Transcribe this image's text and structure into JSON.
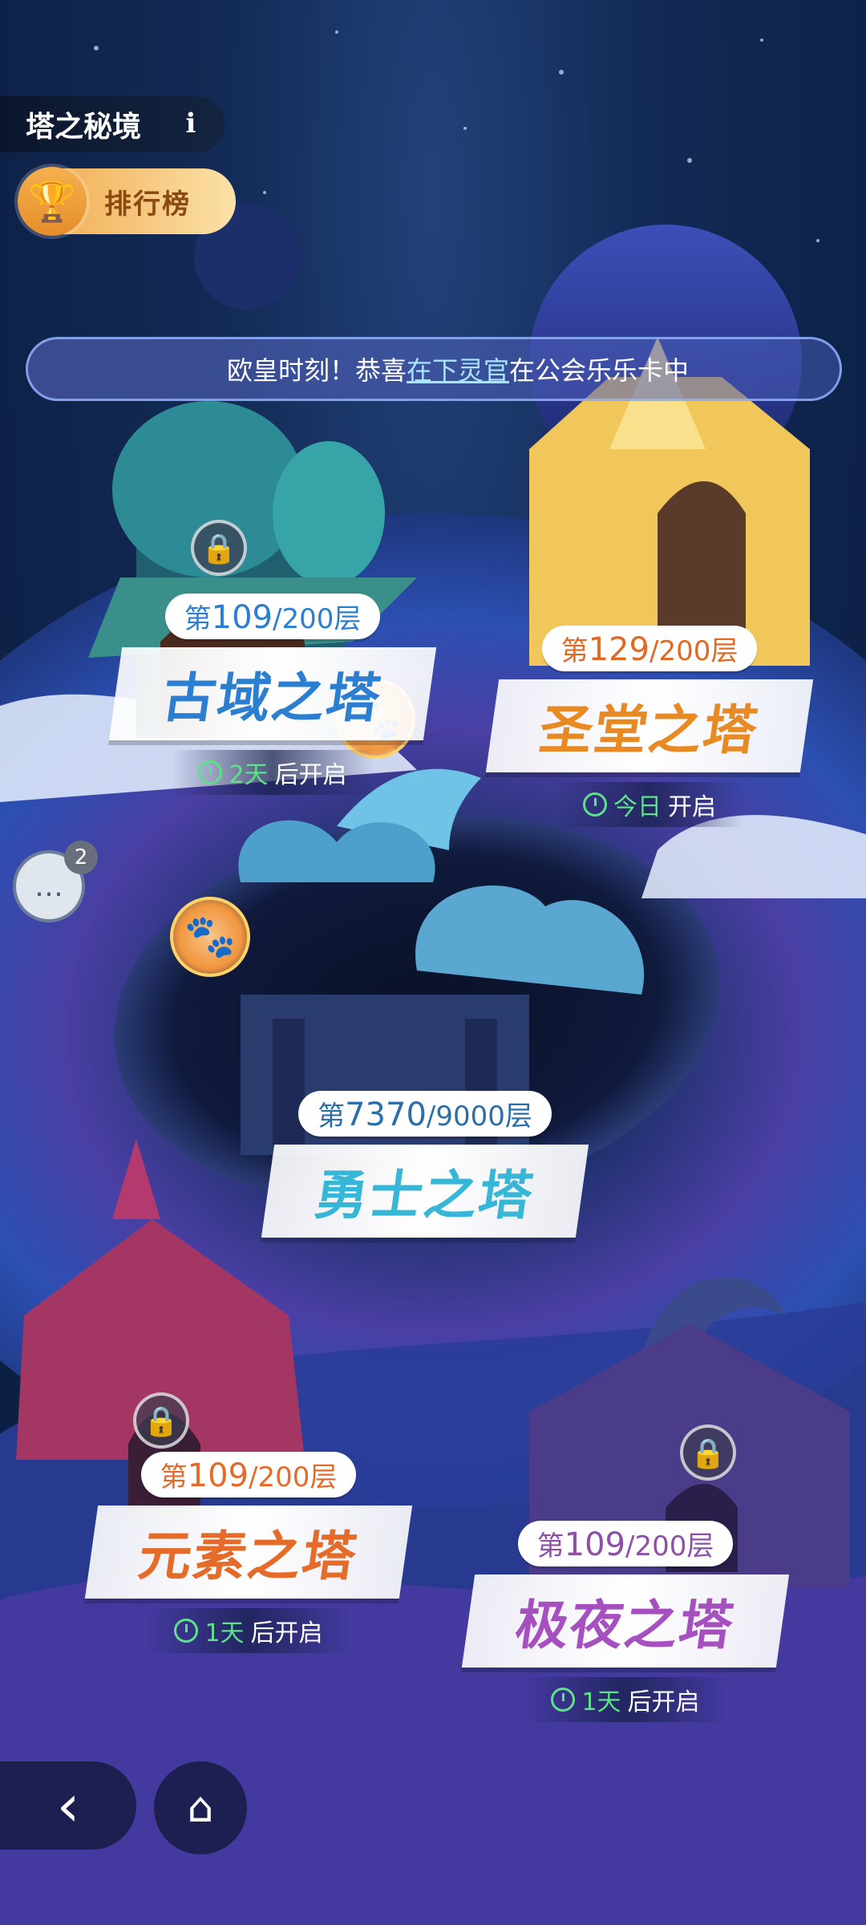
{
  "header": {
    "title": "塔之秘境",
    "info_icon": "i",
    "ranking_label": "排行榜"
  },
  "ticker": {
    "prefix": "欧皇时刻！恭喜",
    "highlight": "在下灵官",
    "suffix": "在公会乐乐卡中"
  },
  "towers": {
    "ancient": {
      "name": "古域之塔",
      "floor_prefix": "第",
      "floor_current": "109",
      "floor_total": "/200层",
      "open_num": "2天",
      "open_text": "后开启",
      "locked": true
    },
    "holy": {
      "name": "圣堂之塔",
      "floor_prefix": "第",
      "floor_current": "129",
      "floor_total": "/200层",
      "open_num": "今日",
      "open_text": "开启",
      "locked": false
    },
    "warrior": {
      "name": "勇士之塔",
      "floor_prefix": "第",
      "floor_current": "7370",
      "floor_total": "/9000层"
    },
    "element": {
      "name": "元素之塔",
      "floor_prefix": "第",
      "floor_current": "109",
      "floor_total": "/200层",
      "open_num": "1天",
      "open_text": "后开启",
      "locked": true
    },
    "night": {
      "name": "极夜之塔",
      "floor_prefix": "第",
      "floor_current": "109",
      "floor_total": "/200层",
      "open_num": "1天",
      "open_text": "后开启",
      "locked": true
    }
  },
  "chat": {
    "badge": "2"
  },
  "colors": {
    "ancient": "#2c7fd0",
    "holy": "#e88a24",
    "warrior": "#38b6d8",
    "element": "#e56b2b",
    "night": "#a64fbf",
    "open_green": "#5fe08a"
  }
}
